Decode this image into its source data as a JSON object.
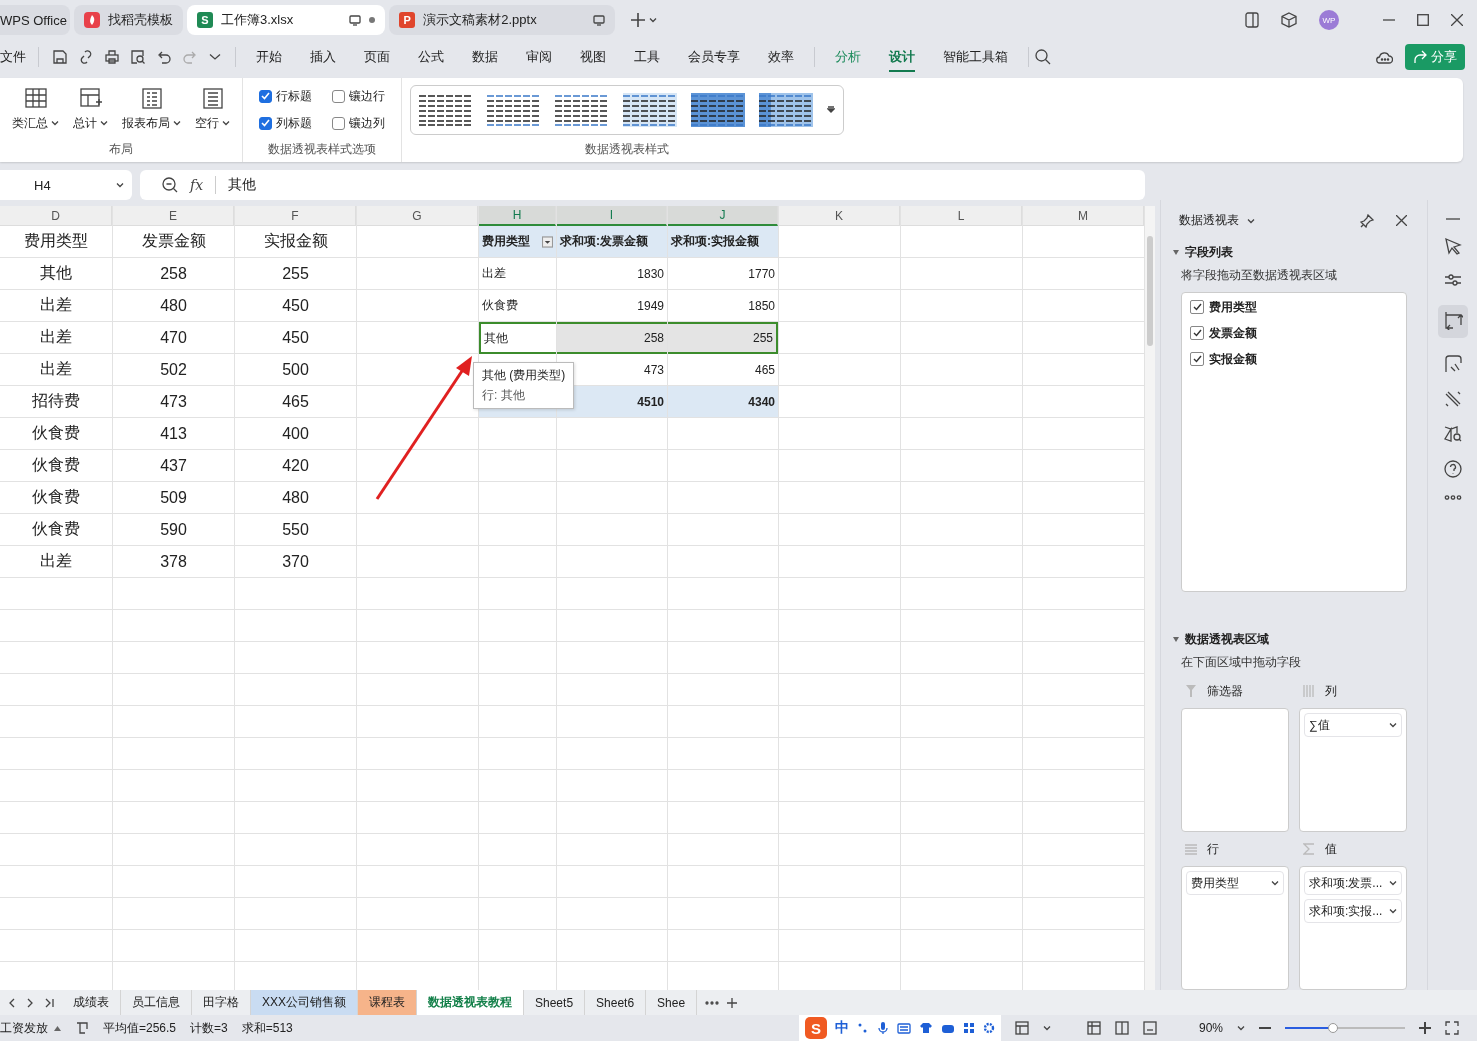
{
  "title_tabs": [
    {
      "label": "WPS Office",
      "kind": "home",
      "selected": false
    },
    {
      "label": "找稻壳模板",
      "kind": "docer",
      "selected": false
    },
    {
      "label": "工作簿3.xlsx",
      "kind": "sheet",
      "badge": "S",
      "selected": true
    },
    {
      "label": "演示文稿素材2.pptx",
      "kind": "slides",
      "badge": "P",
      "selected": false
    }
  ],
  "avatar": "WP",
  "menu": {
    "file": "文件",
    "items": [
      {
        "label": "开始",
        "contextual": false,
        "selected": false
      },
      {
        "label": "插入",
        "contextual": false,
        "selected": false
      },
      {
        "label": "页面",
        "contextual": false,
        "selected": false
      },
      {
        "label": "公式",
        "contextual": false,
        "selected": false
      },
      {
        "label": "数据",
        "contextual": false,
        "selected": false
      },
      {
        "label": "审阅",
        "contextual": false,
        "selected": false
      },
      {
        "label": "视图",
        "contextual": false,
        "selected": false
      },
      {
        "label": "工具",
        "contextual": false,
        "selected": false
      },
      {
        "label": "会员专享",
        "contextual": false,
        "selected": false
      },
      {
        "label": "效率",
        "contextual": false,
        "selected": false
      },
      {
        "label": "分析",
        "contextual": true,
        "selected": false
      },
      {
        "label": "设计",
        "contextual": true,
        "selected": true
      },
      {
        "label": "智能工具箱",
        "contextual": false,
        "selected": false
      }
    ],
    "share": "分享"
  },
  "ribbon": {
    "layout_group": {
      "label": "布局",
      "buttons": [
        "类汇总",
        "总计",
        "报表布局",
        "空行"
      ]
    },
    "options_group": {
      "label": "数据透视表样式选项",
      "options": [
        {
          "label": "行标题",
          "checked": true
        },
        {
          "label": "镶边行",
          "checked": false
        },
        {
          "label": "列标题",
          "checked": true
        },
        {
          "label": "镶边列",
          "checked": false
        }
      ]
    },
    "styles_group": {
      "label": "数据透视表样式"
    }
  },
  "formula_bar": {
    "cell": "H4",
    "fx": "fx",
    "value": "其他"
  },
  "sheet": {
    "columns": [
      {
        "letter": "D",
        "selected": false
      },
      {
        "letter": "E",
        "selected": false
      },
      {
        "letter": "F",
        "selected": false
      },
      {
        "letter": "G",
        "selected": false
      },
      {
        "letter": "H",
        "selected": true
      },
      {
        "letter": "I",
        "selected": true
      },
      {
        "letter": "J",
        "selected": true
      },
      {
        "letter": "K",
        "selected": false
      },
      {
        "letter": "L",
        "selected": false
      },
      {
        "letter": "M",
        "selected": false
      }
    ],
    "source_rows": [
      [
        "费用类型",
        "发票金额",
        "实报金额"
      ],
      [
        "其他",
        "258",
        "255"
      ],
      [
        "出差",
        "480",
        "450"
      ],
      [
        "出差",
        "470",
        "450"
      ],
      [
        "出差",
        "502",
        "500"
      ],
      [
        "招待费",
        "473",
        "465"
      ],
      [
        "伙食费",
        "413",
        "400"
      ],
      [
        "伙食费",
        "437",
        "420"
      ],
      [
        "伙食费",
        "509",
        "480"
      ],
      [
        "伙食费",
        "590",
        "550"
      ],
      [
        "出差",
        "378",
        "370"
      ]
    ],
    "pivot": {
      "header": [
        "费用类型",
        "求和项:发票金额",
        "求和项:实报金额"
      ],
      "rows": [
        {
          "label": "出差",
          "invoice": "1830",
          "reimbursed": "1770",
          "selected": false
        },
        {
          "label": "伙食费",
          "invoice": "1949",
          "reimbursed": "1850",
          "selected": false
        },
        {
          "label": "其他",
          "invoice": "258",
          "reimbursed": "255",
          "selected": true
        },
        {
          "invoice": "473",
          "reimbursed": "465",
          "selected": false
        }
      ],
      "total": {
        "invoice": "4510",
        "reimbursed": "4340"
      }
    },
    "tooltip": {
      "title": "其他 (费用类型)",
      "detail": "行: 其他"
    }
  },
  "sheet_tabs": [
    {
      "label": "成绩表",
      "selected": false
    },
    {
      "label": "员工信息",
      "selected": false
    },
    {
      "label": "田字格",
      "selected": false
    },
    {
      "label": "XXX公司销售额",
      "selected": false,
      "color": "#c9dcf2"
    },
    {
      "label": "课程表",
      "selected": false,
      "color": "#f6b48a"
    },
    {
      "label": "数据透视表教程",
      "selected": true
    },
    {
      "label": "Sheet5",
      "selected": false
    },
    {
      "label": "Sheet6",
      "selected": false
    },
    {
      "label": "Shee",
      "selected": false
    }
  ],
  "status_bar": {
    "macro": "工资发放",
    "stats": [
      "平均值=256.5",
      "计数=3",
      "求和=513"
    ],
    "ime_logo": "S",
    "ime_mode": "中",
    "zoom": "90%",
    "zoom_slider": {
      "level": 0.4
    }
  },
  "pivot_panel": {
    "title": "数据透视表",
    "field_section": "字段列表",
    "field_hint": "将字段拖动至数据透视表区域",
    "fields": [
      {
        "label": "费用类型",
        "checked": true
      },
      {
        "label": "发票金额",
        "checked": true
      },
      {
        "label": "实报金额",
        "checked": true
      }
    ],
    "area_section": "数据透视表区域",
    "area_hint": "在下面区域中拖动字段",
    "areas": [
      {
        "kind": "filter",
        "label": "筛选器"
      },
      {
        "kind": "columns",
        "label": "列",
        "items": [
          "∑值"
        ]
      },
      {
        "kind": "rows",
        "label": "行",
        "items": [
          "费用类型"
        ]
      },
      {
        "kind": "values",
        "label": "值",
        "items": [
          "求和项:发票...",
          "求和项:实报..."
        ]
      }
    ]
  }
}
